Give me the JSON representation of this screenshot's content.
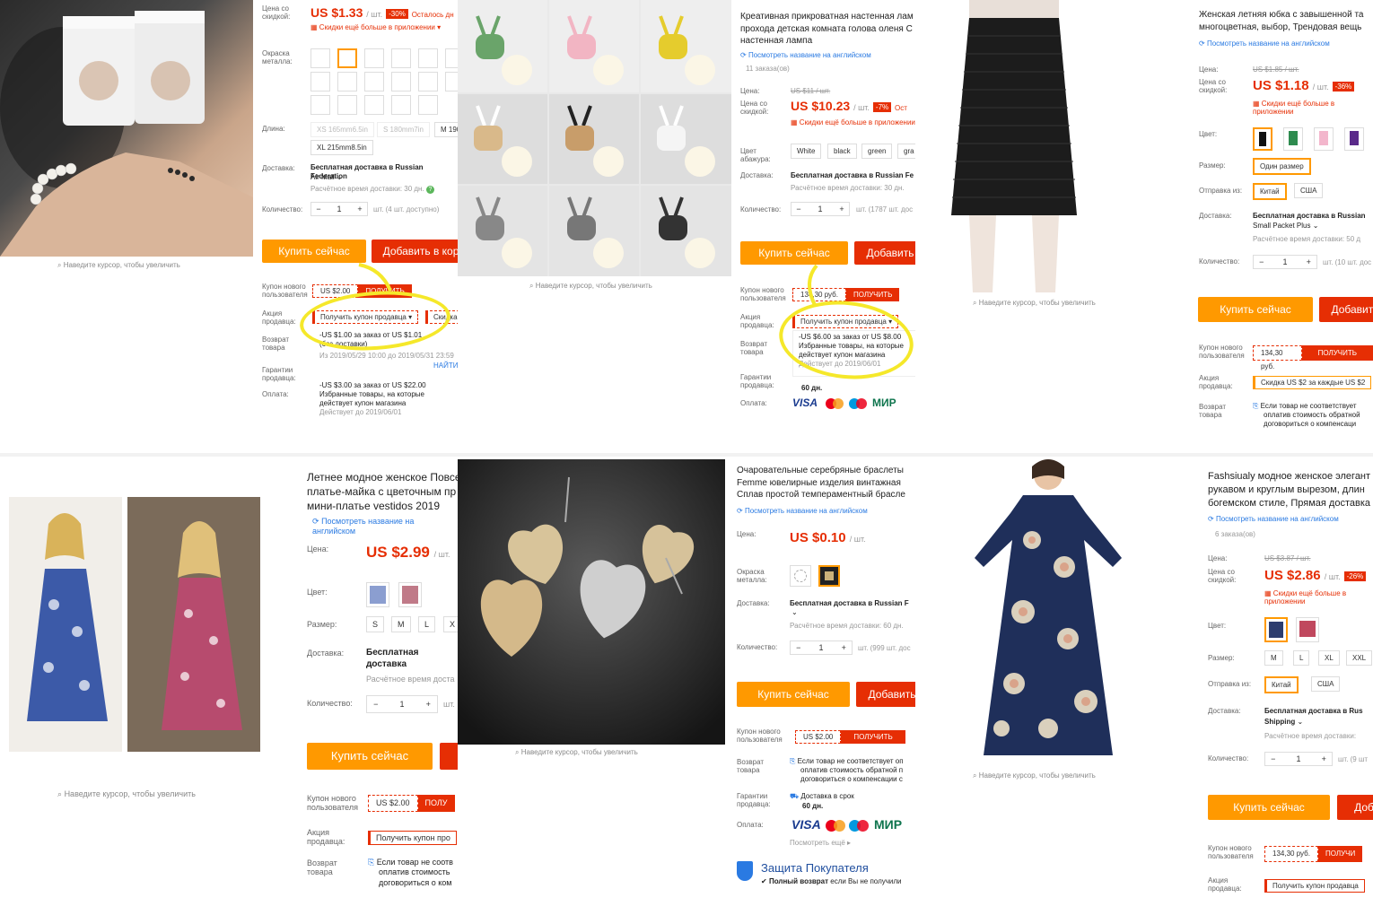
{
  "common": {
    "zoom_hint": "Наведите курсор, чтобы увеличить",
    "buy_now": "Купить сейчас",
    "add_short": "Добавить",
    "add_to_cart": "Добавить в кор",
    "get": "ПОЛУЧИТЬ",
    "view_en": "Посмотреть название на английском",
    "per_unit": "/ шт.",
    "free_ship": "Бесплатная доставка в Russian Federation",
    "app_discount": "Скидки ещё больше в приложении",
    "colors": {
      "accent": "#e62e04",
      "buy": "#ff9900",
      "link": "#2a7ae2",
      "highlight": "#f5e82a"
    }
  },
  "p1": {
    "discount_label": "Цена со скидкой:",
    "price": "US $1.33",
    "badge": "-30%",
    "left_text": "Осталось дн",
    "app_discount": "Скидки ещё больше в приложении",
    "metal_label": "Окраска металла:",
    "length_label": "Длина:",
    "lengths": [
      "XS 165mm6.5in",
      "S 180mm7in",
      "M 190",
      "XL 215mm8.5in"
    ],
    "delivery_label": "Доставка:",
    "delivery": "Бесплатная доставка в Russian Federation",
    "delivery2": "Air Mail",
    "eta": "Расчётное время доставки: 30 дн.",
    "qty_label": "Количество:",
    "qty": "1",
    "stock": "шт. (4 шт. доступно)",
    "new_user_label": "Купон нового пользователя",
    "coupon": "US $2.00",
    "seller_label": "Акция продавца:",
    "seller_coupon": "Получить купон продавца",
    "seller_tab": "Скидка",
    "promo1a": "-US $1.00 за заказ от US $1.01",
    "promo1b": "(без доставки)",
    "promo1c": "Из 2019/05/29 10:00 до 2019/05/31 23:59",
    "find": "НАЙТИ",
    "promo2a": "-US $3.00 за заказ от US $22.00",
    "promo2b": "Избранные товары, на которые",
    "promo2c": "действует купон магазина",
    "promo2d": "Действует до 2019/06/01",
    "return_label": "Возврат товара",
    "guarantee_label": "Гарантии продавца:",
    "payment_label": "Оплата:"
  },
  "p2": {
    "title": "Креативная прикроватная настенная лам проходa детская комната голова оленя С настенная лампа",
    "orders": "11 заказа(ов)",
    "price_label": "Цена:",
    "old_price": "US $11 / шт.",
    "discount_label": "Цена со скидкой:",
    "price": "US $10.23",
    "badge": "-7%",
    "left_text": "Ост",
    "shade_label": "Цвет абажура:",
    "shades": [
      "White",
      "black",
      "green",
      "gra"
    ],
    "delivery_label": "Доставка:",
    "delivery": "Бесплатная доставка в Russian Fe",
    "eta": "Расчётное время доставки: 30 дн.",
    "qty_label": "Количество:",
    "qty": "1",
    "stock": "шт. (1787 шт. дос",
    "new_user_label": "Купон нового пользователя",
    "coupon": "134,30 руб.",
    "seller_label": "Акция продавца:",
    "seller_coupon": "Получить купон продавца",
    "promo_a": "-US $6.00 за заказ от US $8.00",
    "promo_b": "Избранные товары, на которые",
    "promo_c": "действует купон магазина",
    "promo_d": "Действует до 2019/06/01",
    "return_label": "Возврат товара",
    "guarantee_label": "Гарантии продавца:",
    "days": "60 дн.",
    "payment_label": "Оплата:",
    "pay": [
      "VISA",
      "MasterCard",
      "Maestro",
      "МИР"
    ]
  },
  "p3": {
    "title": "Женская летняя юбка с завышенной та многоцветная, выбор, Трендовая вещь",
    "price_label": "Цена:",
    "old_price": "US $1.85 / шт.",
    "discount_label": "Цена со скидкой:",
    "price": "US $1.18",
    "badge": "-36%",
    "color_label": "Цвет:",
    "size_label": "Размер:",
    "size": "Один размер",
    "ship_label": "Отправка из:",
    "ship": [
      "Китай",
      "США"
    ],
    "delivery_label": "Доставка:",
    "delivery": "Бесплатная доставка в Russian",
    "delivery2": "Small Packet Plus",
    "eta": "Расчётное время доставки: 50 д",
    "qty_label": "Количество:",
    "qty": "1",
    "stock": "шт. (10 шт. дос",
    "new_user_label": "Купон нового пользователя",
    "coupon": "134,30 руб.",
    "seller_label": "Акция продавца:",
    "seller_coupon": "Скидка US $2 за каждые US $2",
    "return_label": "Возврат товара",
    "return_a": "Если товар не соответствует",
    "return_b": "оплатив стоимость обратной",
    "return_c": "договориться о компенсаци"
  },
  "p4": {
    "title": "Летнее модное женское Повсе платье-майка с цветочным пр мини-платье vestidos 2019",
    "price_label": "Цена:",
    "price": "US $2.99",
    "color_label": "Цвет:",
    "size_label": "Размер:",
    "sizes": [
      "S",
      "M",
      "L",
      "X"
    ],
    "delivery_label": "Доставка:",
    "delivery": "Бесплатная доставка",
    "eta": "Расчётное время доста",
    "qty_label": "Количество:",
    "qty": "1",
    "stock": "шт.",
    "new_user_label": "Купон нового пользователя",
    "coupon": "US $2.00",
    "get": "ПОЛУ",
    "seller_label": "Акция продавца:",
    "seller_coupon": "Получить купон про",
    "return_label": "Возврат товара",
    "return_a": "Если товар не соотв",
    "return_b": "оплатив стоимость",
    "return_c": "договориться о ком"
  },
  "p5": {
    "title": "Очаровательные серебряные браслеты Femme ювелирные изделия винтажная Сплав простой темпераментный брасле",
    "price_label": "Цена:",
    "price": "US $0.10",
    "metal_label": "Окраска металла:",
    "delivery_label": "Доставка:",
    "delivery": "Бесплатная доставка в Russian F",
    "eta": "Расчётное время доставки: 60 дн.",
    "qty_label": "Количество:",
    "qty": "1",
    "stock": "шт. (999 шт. дос",
    "new_user_label": "Купон нового пользователя",
    "coupon": "US $2.00",
    "return_label": "Возврат товара",
    "return_a": "Если товар не соответствует оп",
    "return_b": "оплатив стоимость обратной п",
    "return_c": "договориться о компенсации с",
    "guarantee_label": "Гарантии продавца:",
    "on_time": "Доставка в срок",
    "days": "60 дн.",
    "payment_label": "Оплата:",
    "pay": [
      "VISA",
      "MasterCard",
      "Maestro",
      "МИР"
    ],
    "more": "Посмотреть ещё",
    "protect": "Защита Покупателя",
    "refund_bold": "Полный возврат",
    "refund_rest": "если Вы не получили"
  },
  "p6": {
    "title": "Fashsiualy модное женское элегант рукавом и круглым вырезом, длин богемском стиле, Прямая доставка",
    "orders": "6 заказа(ов)",
    "price_label": "Цена:",
    "old_price": "US $3.87 / шт.",
    "discount_label": "Цена со скидкой:",
    "price": "US $2.86",
    "badge": "-26%",
    "color_label": "Цвет:",
    "size_label": "Размер:",
    "sizes": [
      "M",
      "L",
      "XL",
      "XXL"
    ],
    "ship_label": "Отправка из:",
    "ship": [
      "Китай",
      "США"
    ],
    "delivery_label": "Доставка:",
    "delivery": "Бесплатная доставка в Rus",
    "delivery2": "Shipping",
    "eta": "Расчётное время доставки:",
    "qty_label": "Количество:",
    "qty": "1",
    "stock": "шт. (9 шт",
    "new_user_label": "Купон нового пользователя",
    "coupon": "134,30 руб.",
    "get": "ПОЛУЧИ",
    "seller_label": "Акция продавца:",
    "seller_coupon": "Получить купон продавца",
    "add": "Доб"
  }
}
